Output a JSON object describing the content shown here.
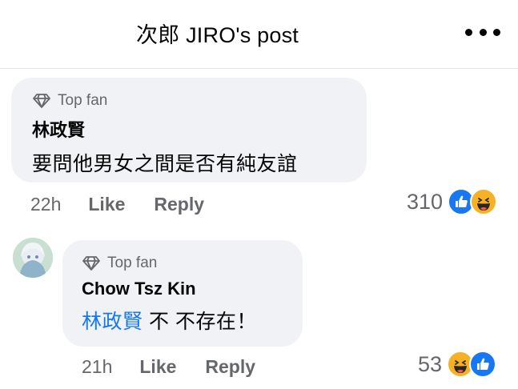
{
  "header": {
    "title": "次郎 JIRO's post"
  },
  "comments": [
    {
      "badge": "Top fan",
      "author": "林政賢",
      "text": "要問他男女之間是否有純友誼",
      "time": "22h",
      "like_label": "Like",
      "reply_label": "Reply",
      "reaction_count": "310",
      "reactions": [
        "like",
        "haha"
      ]
    },
    {
      "badge": "Top fan",
      "author": "Chow Tsz Kin",
      "mention": "林政賢",
      "text": " 不 不存在！",
      "time": "21h",
      "like_label": "Like",
      "reply_label": "Reply",
      "reaction_count": "53",
      "reactions": [
        "haha",
        "like"
      ]
    }
  ],
  "colors": {
    "mention": "#1877f2",
    "like": "#1877f2",
    "haha": "#f7b125",
    "bubble": "#f0f2f5"
  }
}
